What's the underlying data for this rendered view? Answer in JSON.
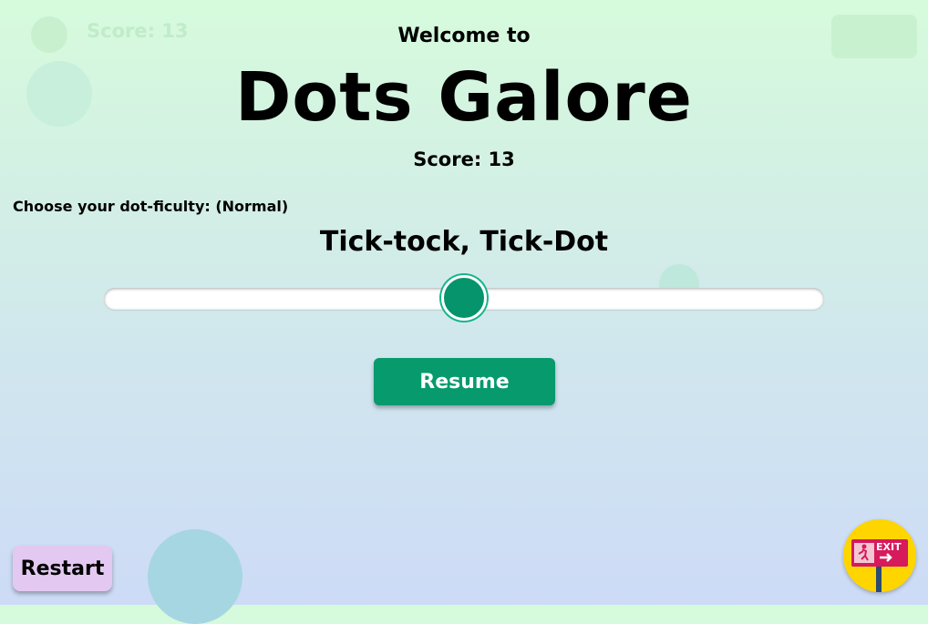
{
  "header": {
    "welcome": "Welcome to",
    "title": "Dots Galore",
    "score_text": "Score: 13",
    "ghost_score_text": "Score: 13"
  },
  "difficulty": {
    "label": "Choose your dot-ficulty: (Normal)",
    "level_name": "Tick-tock, Tick-Dot",
    "slider_value": 0.5
  },
  "buttons": {
    "resume": "Resume",
    "restart": "Restart",
    "exit_icon": "exit-sign-icon",
    "exit_sign_text": "EXIT"
  },
  "colors": {
    "accent": "#069a6d",
    "restart": "#e3c9f2",
    "exit": "#ffd500",
    "exit_sign": "#d61a5c"
  }
}
